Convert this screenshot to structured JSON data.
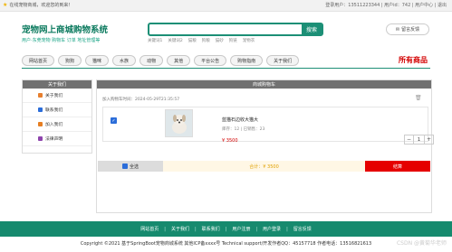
{
  "topbar": {
    "welcome": "在线宠物商城，欢迎您的到来！",
    "user_info": "登录用户：13511223344 | 用户id：742 | 用户中心 | 退出"
  },
  "brand": {
    "title": "宠物网上商城购物系统",
    "subtitle": "用户·东莞宠物 购物车 订单 地址管理等"
  },
  "search": {
    "placeholder": "",
    "button": "搜索",
    "hot_words": [
      "关键词1",
      "关键词2",
      "猫粮",
      "狗粮",
      "猫砂",
      "狗链",
      "宠物衣"
    ]
  },
  "message_button": {
    "label": "留言反馈"
  },
  "nav": {
    "items": [
      "网站首页",
      "狗狗",
      "猫咪",
      "水族",
      "动物",
      "其他",
      "平台公告",
      "购物指南",
      "关于我们"
    ],
    "highlight": "所有商品"
  },
  "sidebar": {
    "title": "关于我们",
    "items": [
      {
        "label": "关于我们",
        "color": "#e77f2f"
      },
      {
        "label": "联系我们",
        "color": "#2b6dd9"
      },
      {
        "label": "加入我们",
        "color": "#e67e22"
      },
      {
        "label": "法律声明",
        "color": "#8e44ad"
      }
    ]
  },
  "cart": {
    "title": "商城购物车",
    "added_time": "加入购物车时间：2024-05-29T21:35:57",
    "item": {
      "name": "蓝猫石边收大猫大",
      "stock": "库存：12 | 已销售：23",
      "price": "¥ 3500",
      "quantity": "1"
    },
    "select_all": "全选",
    "total": "合计：¥ 3500",
    "settle": "结算"
  },
  "footer": {
    "links": [
      "网站首页",
      "关于我们",
      "联系我们",
      "用户注册",
      "用户登录",
      "留言反馈"
    ],
    "copyright": "Copyright ©2021 基于SpringBoot宠物商城系统   其他ICP备xxxx号   Technical support/开发作者QQ：45157718  作者电话：13516821613",
    "watermark": "CSDN @黄菊华老师"
  }
}
